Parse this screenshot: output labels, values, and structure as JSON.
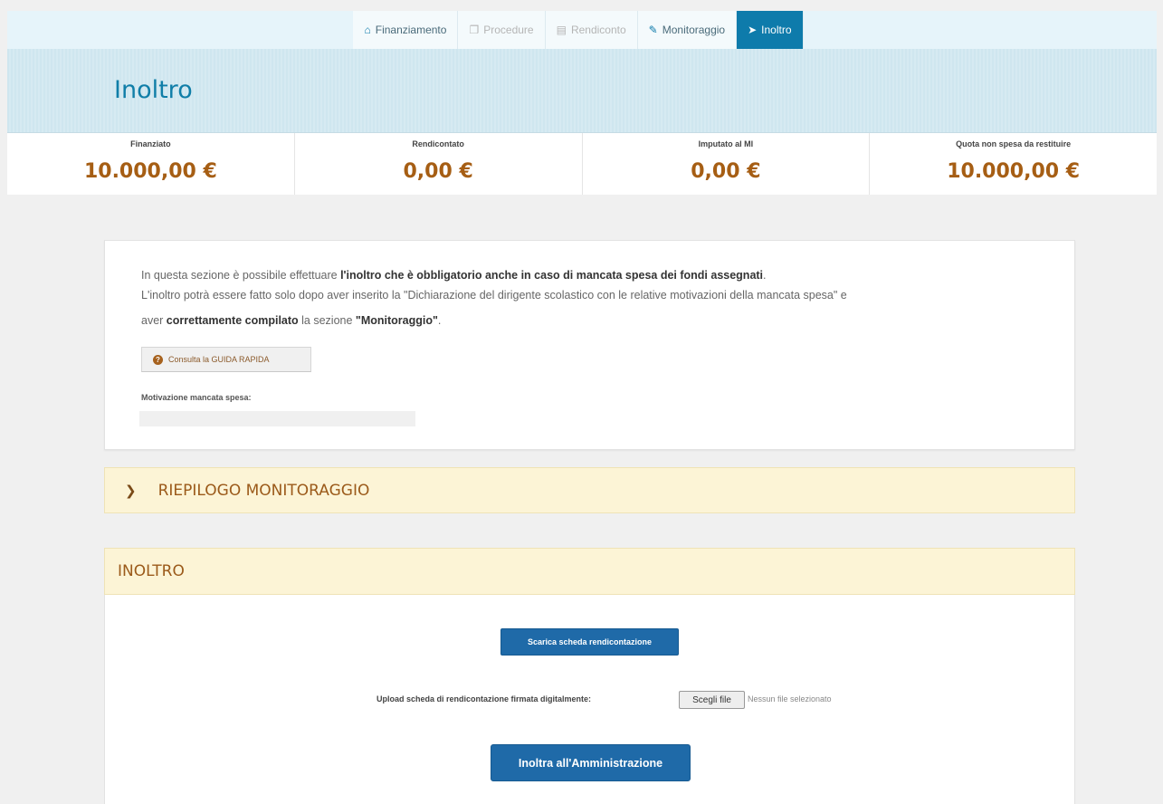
{
  "nav": {
    "tabs": [
      {
        "label": "Finanziamento",
        "icon": "home-icon"
      },
      {
        "label": "Procedure",
        "icon": "copy-icon"
      },
      {
        "label": "Rendiconto",
        "icon": "files-icon"
      },
      {
        "label": "Monitoraggio",
        "icon": "edit-icon"
      },
      {
        "label": "Inoltro",
        "icon": "send-icon"
      }
    ]
  },
  "page": {
    "title": "Inoltro"
  },
  "stats": [
    {
      "label": "Finanziato",
      "value": "10.000,00 €"
    },
    {
      "label": "Rendicontato",
      "value": "0,00 €"
    },
    {
      "label": "Imputato al MI",
      "value": "0,00 €"
    },
    {
      "label": "Quota non spesa da restituire",
      "value": "10.000,00 €"
    }
  ],
  "info": {
    "line1_pre": "In questa sezione è possibile effettuare ",
    "line1_bold": "l'inoltro che è obbligatorio anche in caso di mancata spesa dei fondi assegnati",
    "line1_post": ".",
    "line2": "L'inoltro potrà essere fatto solo dopo aver inserito la \"Dichiarazione del dirigente scolastico con le relative motivazioni della mancata spesa\" e",
    "line3_pre": "aver ",
    "line3_bold1": "correttamente compilato",
    "line3_mid": " la sezione ",
    "line3_bold2": "\"Monitoraggio\"",
    "line3_post": ".",
    "guide_button": "Consulta la GUIDA RAPIDA",
    "motivazione_label": "Motivazione mancata spesa:"
  },
  "riepilogo": {
    "title": "RIEPILOGO MONITORAGGIO"
  },
  "inoltro": {
    "title": "INOLTRO",
    "scarica_button": "Scarica scheda rendicontazione",
    "upload_label": "Upload scheda di rendicontazione firmata digitalmente:",
    "file_button": "Scegli file",
    "file_status": "Nessun file selezionato",
    "submit_button": "Inoltra all'Amministrazione"
  }
}
